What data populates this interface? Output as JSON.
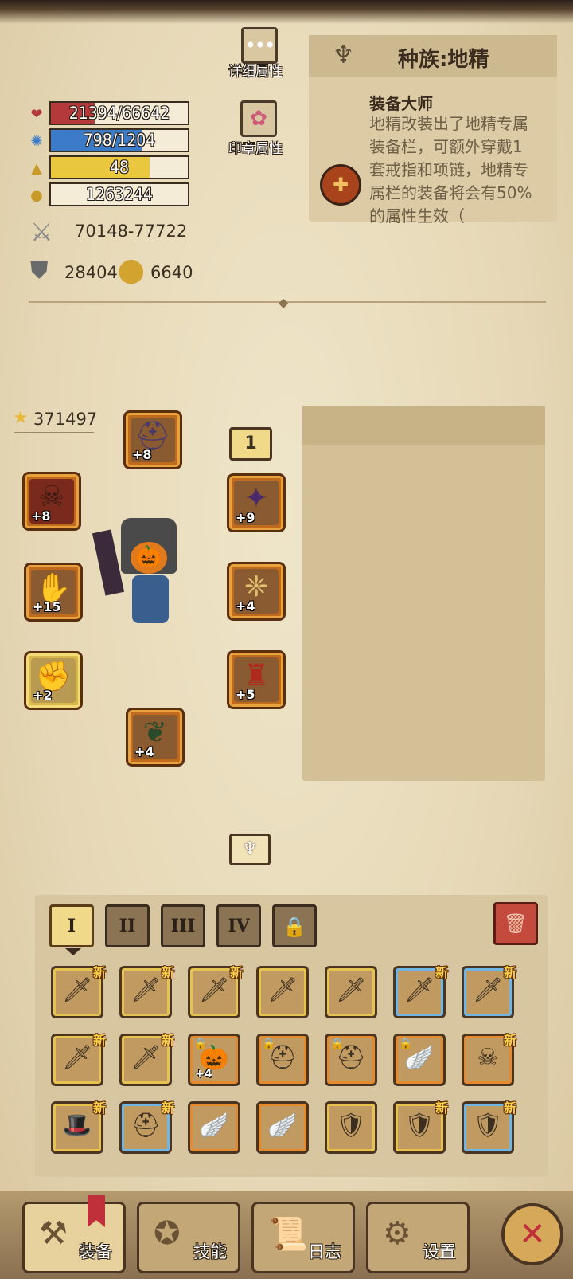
{
  "stats": {
    "hp": {
      "icon": "heart-icon",
      "text": "21394/66642",
      "fill": 0.321,
      "color": "#b4393b"
    },
    "mp": {
      "icon": "gear-mana-icon",
      "text": "798/1204",
      "fill": 0.663,
      "color": "#3c7bc7"
    },
    "level": {
      "icon": "triangle-level-icon",
      "text": "48",
      "fill": 0.72,
      "color": "#e9c83f"
    },
    "exp": {
      "icon": "gold-pile-icon",
      "text": "1263244",
      "fill": 0,
      "color": "#e9c83f"
    },
    "attack": "70148-77722",
    "defense": "28404",
    "gold_stat": "6640",
    "power": "371497"
  },
  "buttons": {
    "detail_label": "详细属性",
    "seal_label": "印章属性"
  },
  "race": {
    "title": "种族:地精",
    "skill_name": "装备大师",
    "skill_desc": "地精改装出了地精专属装备栏，可额外穿戴1套戒指和项链，地精专属栏的装备将会有50%的属性生效（"
  },
  "equip": {
    "helmet": "+8",
    "weapon_left": "+8",
    "shoulder": "+9",
    "gloves": "+15",
    "amulet": "+4",
    "boots_left": "+2",
    "armor": "+5",
    "legs": "+4",
    "slot_badge": "1"
  },
  "tabs": [
    "I",
    "II",
    "III",
    "IV"
  ],
  "inventory": [
    {
      "glyph": "🗡",
      "new": "新",
      "border": "gold"
    },
    {
      "glyph": "🗡",
      "new": "新",
      "border": "gold"
    },
    {
      "glyph": "🗡",
      "new": "新",
      "border": "gold"
    },
    {
      "glyph": "🗡",
      "new": "",
      "border": "gold"
    },
    {
      "glyph": "🗡",
      "new": "",
      "border": "gold"
    },
    {
      "glyph": "🗡",
      "new": "新",
      "border": "blue"
    },
    {
      "glyph": "🗡",
      "new": "新",
      "border": "blue"
    },
    {
      "glyph": "🗡",
      "new": "新",
      "border": "gold"
    },
    {
      "glyph": "🗡",
      "new": "新",
      "border": "gold"
    },
    {
      "glyph": "🎃",
      "new": "",
      "border": "orange",
      "lock": true,
      "plus": "+4"
    },
    {
      "glyph": "⛑",
      "new": "",
      "border": "orange",
      "lock": true
    },
    {
      "glyph": "⛑",
      "new": "",
      "border": "orange",
      "lock": true
    },
    {
      "glyph": "🪽",
      "new": "",
      "border": "orange",
      "lock": true
    },
    {
      "glyph": "☠",
      "new": "新",
      "border": "orange"
    },
    {
      "glyph": "🎩",
      "new": "新",
      "border": "gold"
    },
    {
      "glyph": "⛑",
      "new": "新",
      "border": "blue"
    },
    {
      "glyph": "🪽",
      "new": "",
      "border": "orange"
    },
    {
      "glyph": "🪽",
      "new": "",
      "border": "orange"
    },
    {
      "glyph": "🛡",
      "new": "",
      "border": "gold"
    },
    {
      "glyph": "🛡",
      "new": "新",
      "border": "gold"
    },
    {
      "glyph": "🛡",
      "new": "新",
      "border": "blue"
    }
  ],
  "nav": {
    "equip": "装备",
    "skill": "技能",
    "log": "日志",
    "settings": "设置"
  }
}
